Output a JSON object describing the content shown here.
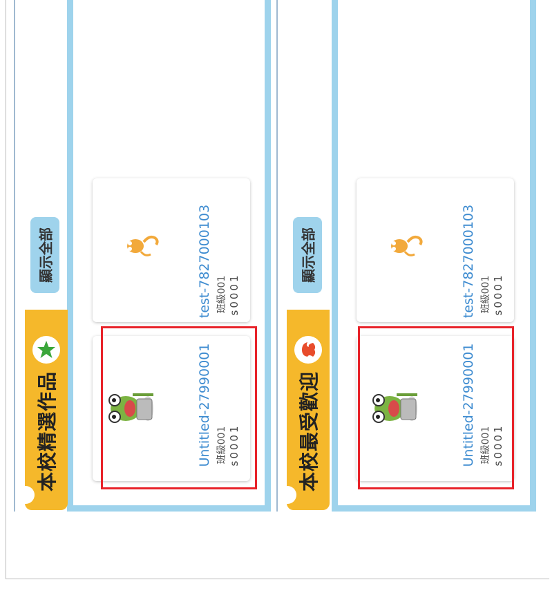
{
  "sections": [
    {
      "title": "本校精選作品",
      "icon": "star-icon",
      "show_all_label": "顯示全部",
      "projects": [
        {
          "title": "Untitled-27990001",
          "class": "班級001",
          "user": "s0001",
          "thumbnail": "frog-icon"
        },
        {
          "title": "test-7827000103",
          "class": "班級001",
          "user": "s0001",
          "thumbnail": "cat-icon"
        }
      ]
    },
    {
      "title": "本校最受歡迎",
      "icon": "flame-icon",
      "show_all_label": "顯示全部",
      "projects": [
        {
          "title": "Untitled-27990001",
          "class": "班級001",
          "user": "s0001",
          "thumbnail": "frog-icon"
        },
        {
          "title": "test-7827000103",
          "class": "班級001",
          "user": "s0001",
          "thumbnail": "cat-icon"
        }
      ]
    }
  ],
  "colors": {
    "accent": "#f5b82b",
    "panel_border": "#9ed3ec",
    "link": "#3d8bd0",
    "highlight": "#e8232a"
  }
}
